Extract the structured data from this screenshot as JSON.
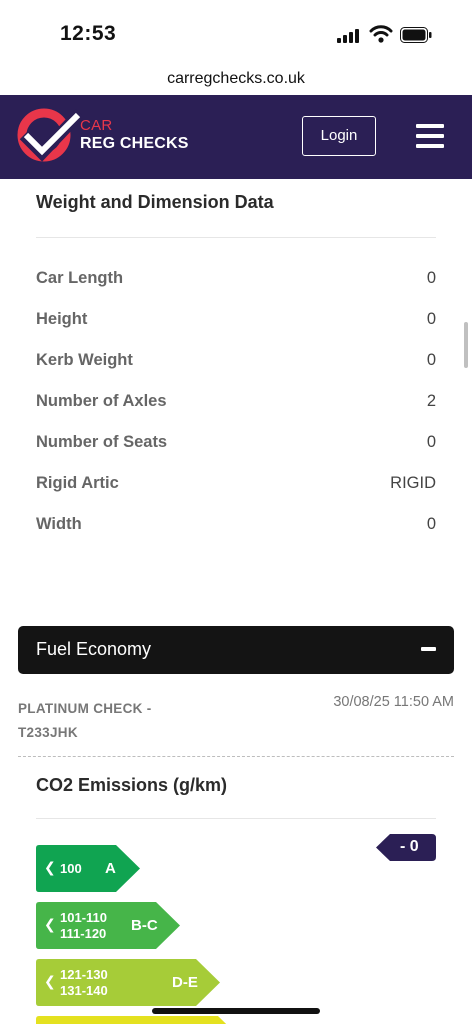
{
  "status_bar": {
    "time": "12:53"
  },
  "browser": {
    "url": "carregchecks.co.uk"
  },
  "header": {
    "logo_line1": "CAR",
    "logo_line2": "REG CHECKS",
    "login_label": "Login",
    "colors": {
      "background": "#2b1f55",
      "logo_accent": "#e8364a"
    }
  },
  "weight_section": {
    "title": "Weight and Dimension Data",
    "rows": [
      {
        "label": "Car Length",
        "value": "0"
      },
      {
        "label": "Height",
        "value": "0"
      },
      {
        "label": "Kerb Weight",
        "value": "0"
      },
      {
        "label": "Number of Axles",
        "value": "2"
      },
      {
        "label": "Number of Seats",
        "value": "0"
      },
      {
        "label": "Rigid Artic",
        "value": "RIGID"
      },
      {
        "label": "Width",
        "value": "0"
      }
    ]
  },
  "fuel_economy": {
    "title": "Fuel Economy",
    "toggle_icon": "minus-icon",
    "check_title": "PLATINUM CHECK - T233JHK",
    "check_date": "30/08/25 11:50 AM",
    "co2_title": "CO2 Emissions (g/km)",
    "co2_value": "- 0",
    "bands": [
      {
        "range": "100",
        "letter": "A",
        "color": "#10a451"
      },
      {
        "range_line1": "101-110",
        "range_line2": "111-120",
        "letter": "B-C",
        "color": "#46b549"
      },
      {
        "range_line1": "121-130",
        "range_line2": "131-140",
        "letter": "D-E",
        "color": "#a6cc38"
      },
      {
        "letter": "",
        "color": "#e4e11f"
      }
    ]
  }
}
